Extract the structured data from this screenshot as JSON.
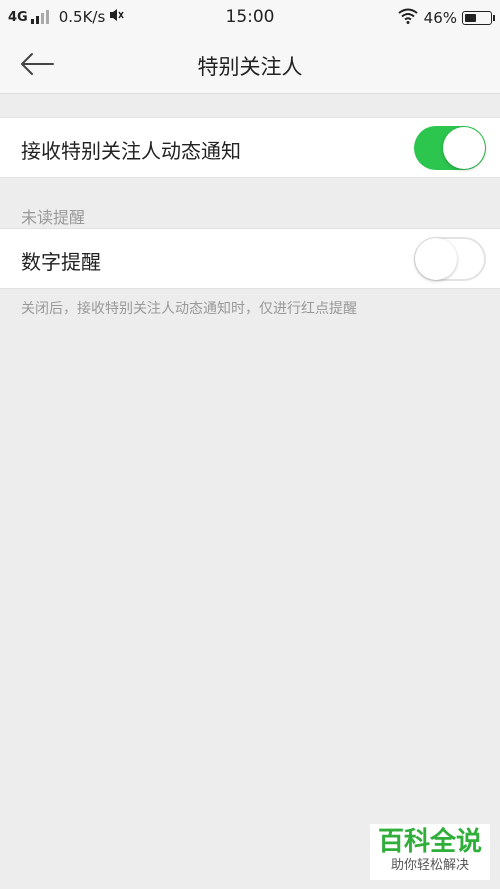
{
  "status_bar": {
    "network": "4G",
    "speed": "0.5K/s",
    "time": "15:00",
    "battery_text": "46%",
    "battery_level": 0.46,
    "icons": [
      "signal-icon",
      "mute-icon",
      "wifi-icon",
      "battery-icon"
    ]
  },
  "nav": {
    "back_icon": "arrow-left-icon",
    "title": "特别关注人"
  },
  "settings": {
    "notify": {
      "label": "接收特别关注人动态通知",
      "enabled": true
    },
    "unread_section_title": "未读提醒",
    "number_reminder": {
      "label": "数字提醒",
      "enabled": false
    },
    "footnote": "关闭后，接收特别关注人动态通知时，仅进行红点提醒"
  },
  "colors": {
    "switch_on": "#2cc54e",
    "background": "#ededed",
    "watermark_green": "#2fae3a"
  },
  "watermark": {
    "main": "百科全说",
    "sub": "助你轻松解决"
  }
}
